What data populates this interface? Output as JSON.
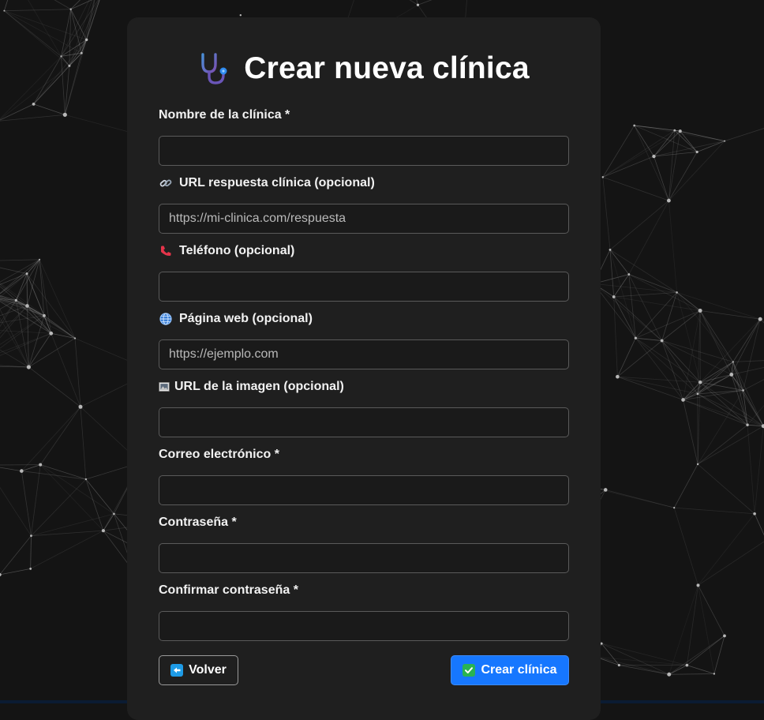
{
  "page": {
    "title": "Crear nueva clínica",
    "accent_color": "#1677ff",
    "background_color": "#141414",
    "card_color": "#1f1f1f"
  },
  "fields": {
    "name": {
      "label": "Nombre de la clínica *",
      "value": "",
      "placeholder": ""
    },
    "response_url": {
      "label": "URL respuesta clínica (opcional)",
      "icon": "link-icon",
      "value": "",
      "placeholder": "https://mi-clinica.com/respuesta"
    },
    "phone": {
      "label": "Teléfono (opcional)",
      "icon": "phone-icon",
      "value": "",
      "placeholder": ""
    },
    "website": {
      "label": "Página web (opcional)",
      "icon": "globe-icon",
      "value": "",
      "placeholder": "https://ejemplo.com"
    },
    "image_url": {
      "label": "URL de la imagen (opcional)",
      "icon": "picture-icon",
      "value": "",
      "placeholder": ""
    },
    "email": {
      "label": "Correo electrónico *",
      "value": "",
      "placeholder": ""
    },
    "password": {
      "label": "Contraseña *",
      "value": "",
      "placeholder": ""
    },
    "confirm_password": {
      "label": "Confirmar contraseña *",
      "value": "",
      "placeholder": ""
    }
  },
  "buttons": {
    "back": {
      "label": "Volver",
      "icon": "left-arrow-icon"
    },
    "create": {
      "label": "Crear clínica",
      "icon": "check-mark-icon"
    }
  }
}
